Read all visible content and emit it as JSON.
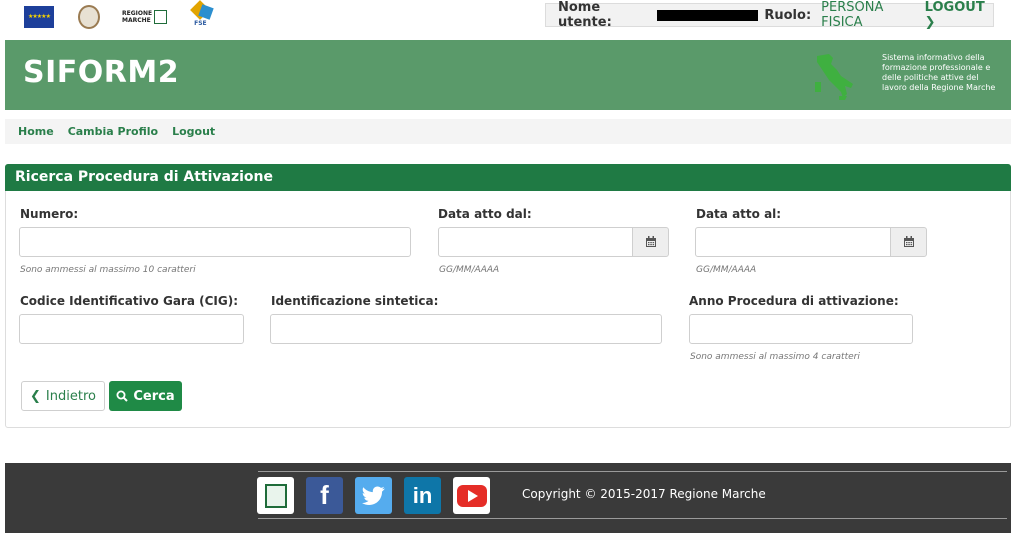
{
  "header": {
    "user_label": "Nome utente:",
    "role_label": "Ruolo:",
    "role_value": "PERSONA FISICA",
    "logout_label": "LOGOUT",
    "logos": {
      "region_line1": "REGIONE",
      "region_line2": "MARCHE",
      "fse": "FSE"
    }
  },
  "banner": {
    "title": "SIFORM2",
    "description": "Sistema informativo della formazione professionale e delle politiche attive del lavoro della Regione Marche"
  },
  "nav": {
    "items": [
      "Home",
      "Cambia Profilo",
      "Logout"
    ]
  },
  "panel": {
    "title": "Ricerca Procedura di Attivazione",
    "fields": {
      "numero": {
        "label": "Numero:",
        "value": "",
        "hint": "Sono ammessi al massimo 10 caratteri"
      },
      "data_dal": {
        "label": "Data atto dal:",
        "value": "",
        "hint": "GG/MM/AAAA"
      },
      "data_al": {
        "label": "Data atto al:",
        "value": "",
        "hint": "GG/MM/AAAA"
      },
      "cig": {
        "label": "Codice Identificativo Gara (CIG):",
        "value": ""
      },
      "identificazione": {
        "label": "Identificazione sintetica:",
        "value": ""
      },
      "anno": {
        "label": "Anno Procedura di attivazione:",
        "value": "",
        "hint": "Sono ammessi al massimo 4 caratteri"
      }
    },
    "buttons": {
      "back": "Indietro",
      "search": "Cerca"
    }
  },
  "footer": {
    "copyright": "Copyright © 2015-2017 Regione Marche",
    "social": [
      "regione-marche-icon",
      "facebook-icon",
      "twitter-icon",
      "linkedin-icon",
      "youtube-icon"
    ]
  },
  "colors": {
    "banner": "#5a9a6a",
    "panel_header": "#1f7a44",
    "accent": "#2a7f4b",
    "footer": "#3a3a3a"
  }
}
